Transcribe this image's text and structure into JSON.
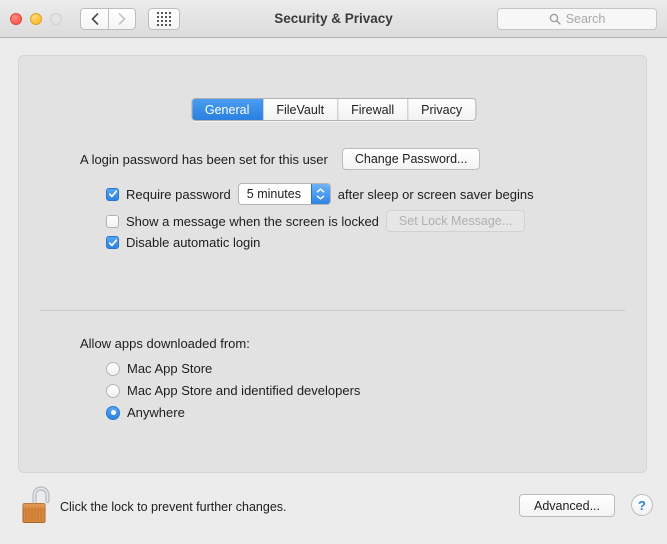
{
  "window": {
    "title": "Security & Privacy",
    "traffic_lights": [
      "close",
      "minimize",
      "zoom"
    ]
  },
  "toolbar": {
    "back_icon": "chevron-left-icon",
    "forward_icon": "chevron-right-icon",
    "show_all_icon": "grid-icon",
    "search": {
      "placeholder": "Search",
      "value": "",
      "icon": "search-icon"
    }
  },
  "tabs": [
    {
      "label": "General",
      "active": true
    },
    {
      "label": "FileVault",
      "active": false
    },
    {
      "label": "Firewall",
      "active": false
    },
    {
      "label": "Privacy",
      "active": false
    }
  ],
  "general": {
    "login_password_status": "A login password has been set for this user",
    "change_password_button": "Change Password...",
    "require_password": {
      "checked": true,
      "label_before": "Require password",
      "interval_value": "5 minutes",
      "label_after": "after sleep or screen saver begins"
    },
    "show_lock_message": {
      "checked": false,
      "label": "Show a message when the screen is locked",
      "button": "Set Lock Message...",
      "button_disabled": true
    },
    "disable_automatic_login": {
      "checked": true,
      "label": "Disable automatic login"
    },
    "allow_apps_heading": "Allow apps downloaded from:",
    "allow_apps_options": [
      {
        "label": "Mac App Store",
        "selected": false
      },
      {
        "label": "Mac App Store and identified developers",
        "selected": false
      },
      {
        "label": "Anywhere",
        "selected": true
      }
    ]
  },
  "footer": {
    "lock_icon": "unlocked-padlock-icon",
    "lock_message": "Click the lock to prevent further changes.",
    "advanced_button": "Advanced...",
    "help_button": "?"
  },
  "colors": {
    "accent_blue": "#2d83e4",
    "tab_active_blue": "#3286e5",
    "window_bg": "#ececec",
    "panel_bg": "#e2e2e2",
    "lock_body": "#d9883f",
    "help_blue": "#2d7fd8"
  }
}
